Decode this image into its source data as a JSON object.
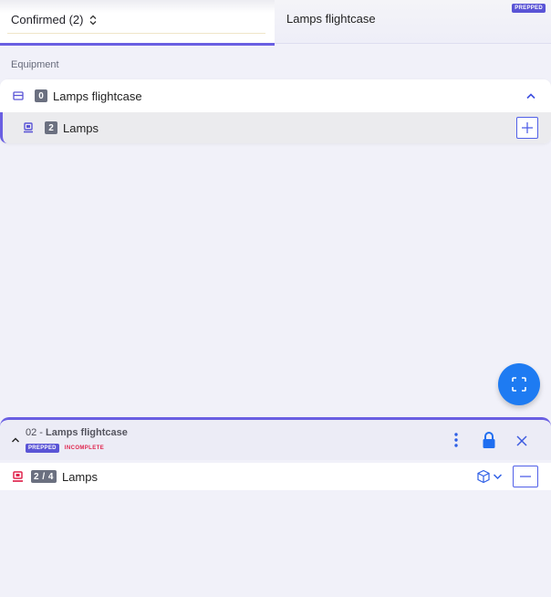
{
  "tabs": {
    "left": {
      "selector_label": "Confirmed (2)"
    },
    "right": {
      "title": "Lamps flightcase",
      "badge": "PREPPED"
    }
  },
  "equipment": {
    "section_label": "Equipment",
    "group": {
      "count": "0",
      "label": "Lamps flightcase"
    },
    "item": {
      "count": "2",
      "label": "Lamps"
    }
  },
  "panel": {
    "title_prefix": "02 - ",
    "title_name": "Lamps flightcase",
    "badge_prepped": "PREPPED",
    "badge_incomplete": "INCOMPLETE",
    "line": {
      "count": "2 / 4",
      "label": "Lamps"
    }
  },
  "colors": {
    "accent": "#6a5fe2",
    "primary": "#1e7bf2",
    "link": "#5160e8",
    "danger": "#e0244d"
  },
  "icons": [
    "sort-icon",
    "case-icon",
    "chevron-up-icon",
    "device-icon",
    "plus-icon",
    "scan-icon",
    "caret-up-icon",
    "kebab-icon",
    "lock-icon",
    "close-icon",
    "box-icon",
    "chevron-down-icon",
    "minus-icon"
  ]
}
